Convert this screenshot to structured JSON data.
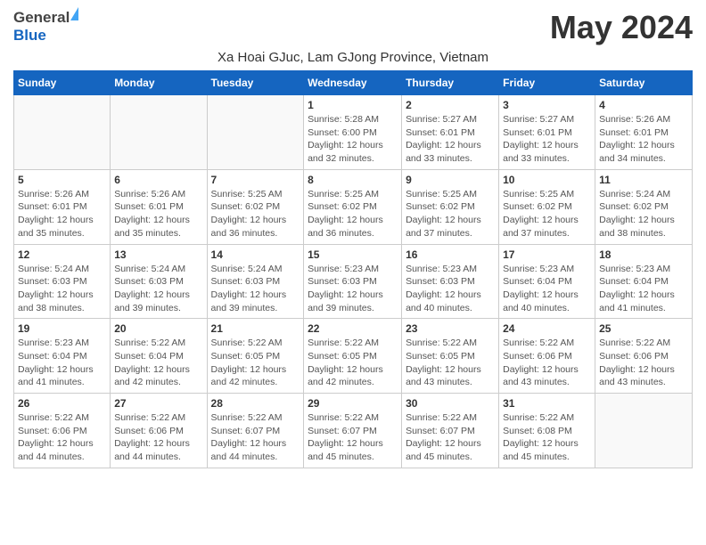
{
  "header": {
    "logo_general": "General",
    "logo_blue": "Blue",
    "month": "May 2024",
    "location": "Xa Hoai GJuc, Lam GJong Province, Vietnam"
  },
  "days_of_week": [
    "Sunday",
    "Monday",
    "Tuesday",
    "Wednesday",
    "Thursday",
    "Friday",
    "Saturday"
  ],
  "weeks": [
    [
      {
        "day": "",
        "info": ""
      },
      {
        "day": "",
        "info": ""
      },
      {
        "day": "",
        "info": ""
      },
      {
        "day": "1",
        "info": "Sunrise: 5:28 AM\nSunset: 6:00 PM\nDaylight: 12 hours and 32 minutes."
      },
      {
        "day": "2",
        "info": "Sunrise: 5:27 AM\nSunset: 6:01 PM\nDaylight: 12 hours and 33 minutes."
      },
      {
        "day": "3",
        "info": "Sunrise: 5:27 AM\nSunset: 6:01 PM\nDaylight: 12 hours and 33 minutes."
      },
      {
        "day": "4",
        "info": "Sunrise: 5:26 AM\nSunset: 6:01 PM\nDaylight: 12 hours and 34 minutes."
      }
    ],
    [
      {
        "day": "5",
        "info": "Sunrise: 5:26 AM\nSunset: 6:01 PM\nDaylight: 12 hours and 35 minutes."
      },
      {
        "day": "6",
        "info": "Sunrise: 5:26 AM\nSunset: 6:01 PM\nDaylight: 12 hours and 35 minutes."
      },
      {
        "day": "7",
        "info": "Sunrise: 5:25 AM\nSunset: 6:02 PM\nDaylight: 12 hours and 36 minutes."
      },
      {
        "day": "8",
        "info": "Sunrise: 5:25 AM\nSunset: 6:02 PM\nDaylight: 12 hours and 36 minutes."
      },
      {
        "day": "9",
        "info": "Sunrise: 5:25 AM\nSunset: 6:02 PM\nDaylight: 12 hours and 37 minutes."
      },
      {
        "day": "10",
        "info": "Sunrise: 5:25 AM\nSunset: 6:02 PM\nDaylight: 12 hours and 37 minutes."
      },
      {
        "day": "11",
        "info": "Sunrise: 5:24 AM\nSunset: 6:02 PM\nDaylight: 12 hours and 38 minutes."
      }
    ],
    [
      {
        "day": "12",
        "info": "Sunrise: 5:24 AM\nSunset: 6:03 PM\nDaylight: 12 hours and 38 minutes."
      },
      {
        "day": "13",
        "info": "Sunrise: 5:24 AM\nSunset: 6:03 PM\nDaylight: 12 hours and 39 minutes."
      },
      {
        "day": "14",
        "info": "Sunrise: 5:24 AM\nSunset: 6:03 PM\nDaylight: 12 hours and 39 minutes."
      },
      {
        "day": "15",
        "info": "Sunrise: 5:23 AM\nSunset: 6:03 PM\nDaylight: 12 hours and 39 minutes."
      },
      {
        "day": "16",
        "info": "Sunrise: 5:23 AM\nSunset: 6:03 PM\nDaylight: 12 hours and 40 minutes."
      },
      {
        "day": "17",
        "info": "Sunrise: 5:23 AM\nSunset: 6:04 PM\nDaylight: 12 hours and 40 minutes."
      },
      {
        "day": "18",
        "info": "Sunrise: 5:23 AM\nSunset: 6:04 PM\nDaylight: 12 hours and 41 minutes."
      }
    ],
    [
      {
        "day": "19",
        "info": "Sunrise: 5:23 AM\nSunset: 6:04 PM\nDaylight: 12 hours and 41 minutes."
      },
      {
        "day": "20",
        "info": "Sunrise: 5:22 AM\nSunset: 6:04 PM\nDaylight: 12 hours and 42 minutes."
      },
      {
        "day": "21",
        "info": "Sunrise: 5:22 AM\nSunset: 6:05 PM\nDaylight: 12 hours and 42 minutes."
      },
      {
        "day": "22",
        "info": "Sunrise: 5:22 AM\nSunset: 6:05 PM\nDaylight: 12 hours and 42 minutes."
      },
      {
        "day": "23",
        "info": "Sunrise: 5:22 AM\nSunset: 6:05 PM\nDaylight: 12 hours and 43 minutes."
      },
      {
        "day": "24",
        "info": "Sunrise: 5:22 AM\nSunset: 6:06 PM\nDaylight: 12 hours and 43 minutes."
      },
      {
        "day": "25",
        "info": "Sunrise: 5:22 AM\nSunset: 6:06 PM\nDaylight: 12 hours and 43 minutes."
      }
    ],
    [
      {
        "day": "26",
        "info": "Sunrise: 5:22 AM\nSunset: 6:06 PM\nDaylight: 12 hours and 44 minutes."
      },
      {
        "day": "27",
        "info": "Sunrise: 5:22 AM\nSunset: 6:06 PM\nDaylight: 12 hours and 44 minutes."
      },
      {
        "day": "28",
        "info": "Sunrise: 5:22 AM\nSunset: 6:07 PM\nDaylight: 12 hours and 44 minutes."
      },
      {
        "day": "29",
        "info": "Sunrise: 5:22 AM\nSunset: 6:07 PM\nDaylight: 12 hours and 45 minutes."
      },
      {
        "day": "30",
        "info": "Sunrise: 5:22 AM\nSunset: 6:07 PM\nDaylight: 12 hours and 45 minutes."
      },
      {
        "day": "31",
        "info": "Sunrise: 5:22 AM\nSunset: 6:08 PM\nDaylight: 12 hours and 45 minutes."
      },
      {
        "day": "",
        "info": ""
      }
    ]
  ]
}
